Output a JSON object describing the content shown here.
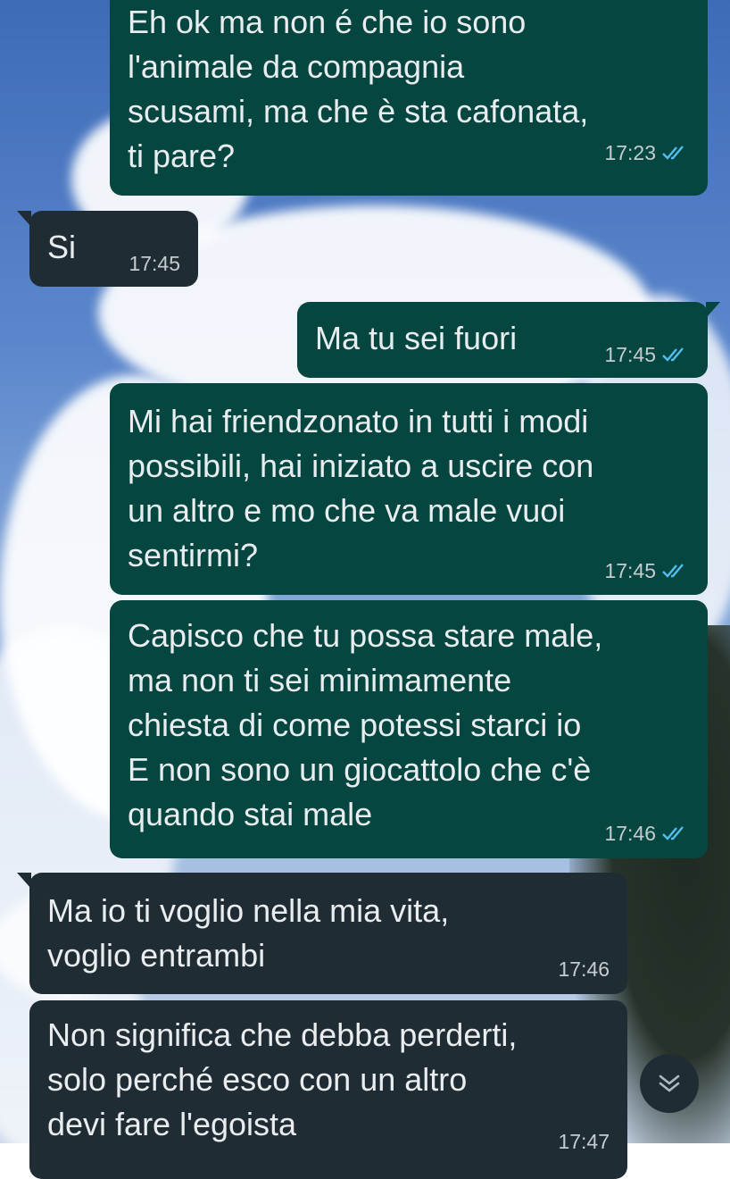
{
  "colors": {
    "outgoing_bubble": "#054640",
    "incoming_bubble": "#202c33",
    "text": "#e9edef",
    "meta_text": "#c5ccd0",
    "read_ticks": "#53bdeb"
  },
  "messages": [
    {
      "direction": "outgoing",
      "text": "Eh ok ma non é che io sono\nl'animale da compagnia\nscusami, ma che è sta cafonata,\nti pare?",
      "time": "17:23",
      "status": "read"
    },
    {
      "direction": "incoming",
      "text": "Si",
      "time": "17:45"
    },
    {
      "direction": "outgoing",
      "text": "Ma tu sei fuori",
      "time": "17:45",
      "status": "read"
    },
    {
      "direction": "outgoing",
      "text": "Mi hai friendzonato in tutti i modi\npossibili, hai iniziato a uscire con\nun altro e mo che va male vuoi\nsentirmi?",
      "time": "17:45",
      "status": "read"
    },
    {
      "direction": "outgoing",
      "text": "Capisco che tu possa stare male,\nma non ti sei minimamente\nchiesta di come potessi starci io\nE non sono un giocattolo che c'è\nquando stai male",
      "time": "17:46",
      "status": "read"
    },
    {
      "direction": "incoming",
      "text": "Ma io ti voglio nella mia vita,\nvoglio entrambi",
      "time": "17:46"
    },
    {
      "direction": "incoming",
      "text": "Non significa che debba perderti,\nsolo perché esco con un altro\ndevi fare l'egoista",
      "time": "17:47"
    }
  ],
  "scroll_button": {
    "icon": "chevrons-down-icon"
  }
}
